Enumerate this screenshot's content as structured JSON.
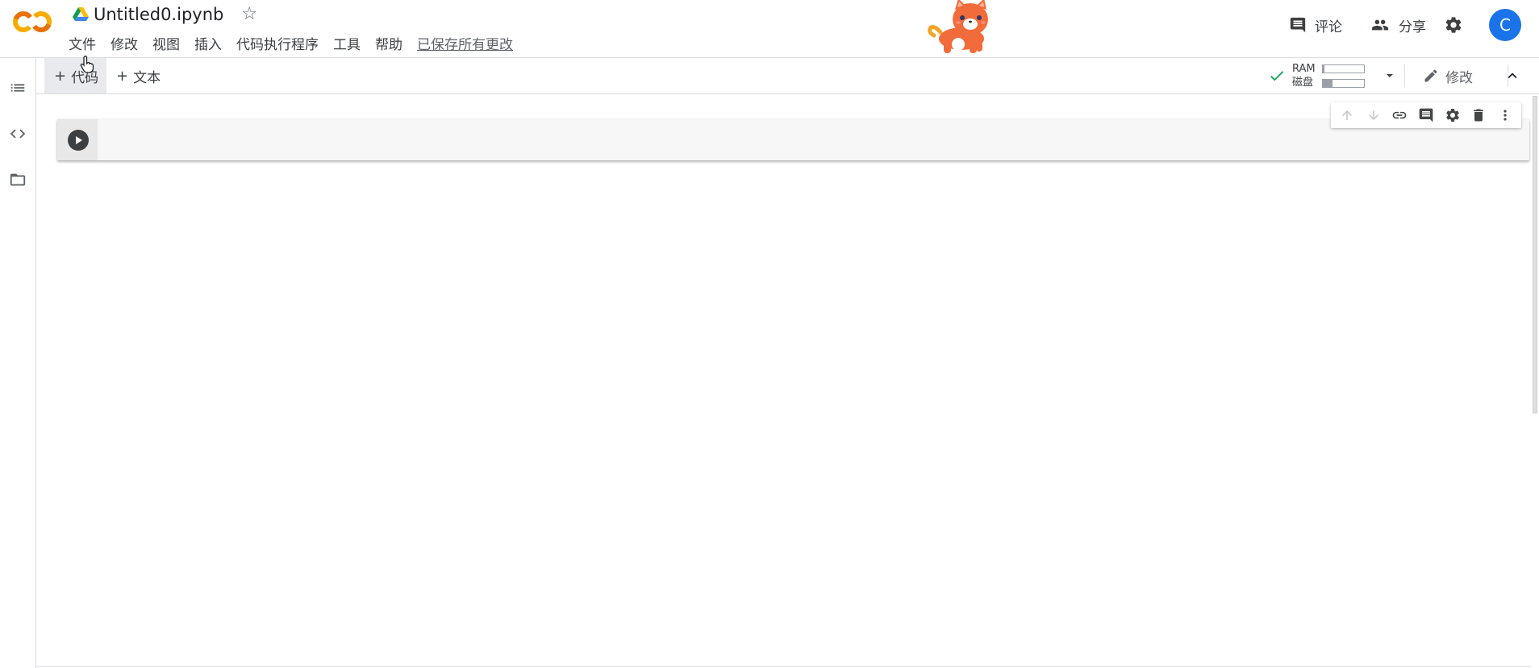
{
  "app": {
    "logo_text": "CO",
    "doc_title": "Untitled0.ipynb"
  },
  "menu": {
    "items": [
      "文件",
      "修改",
      "视图",
      "插入",
      "代码执行程序",
      "工具",
      "帮助"
    ],
    "save_status": "已保存所有更改"
  },
  "header_actions": {
    "comment_label": "评论",
    "share_label": "分享",
    "avatar_initial": "C",
    "accent_color": "#1a73e8"
  },
  "sidebar": {
    "icons": [
      "toc-list-icon",
      "code-snippets-icon",
      "folder-icon"
    ]
  },
  "toolbar": {
    "add_code_label": "代码",
    "add_text_label": "文本",
    "resources": {
      "ram_label": "RAM",
      "disk_label": "磁盘",
      "ram_fraction": 0.04,
      "disk_fraction": 0.25,
      "status_color": "#0f9d58"
    },
    "edit_label": "修改"
  },
  "cell": {
    "type": "code",
    "source": ""
  },
  "cell_toolbar": {
    "icons": [
      "move-up-icon",
      "move-down-icon",
      "link-icon",
      "comment-icon",
      "settings-icon",
      "delete-icon",
      "more-vert-icon"
    ]
  }
}
